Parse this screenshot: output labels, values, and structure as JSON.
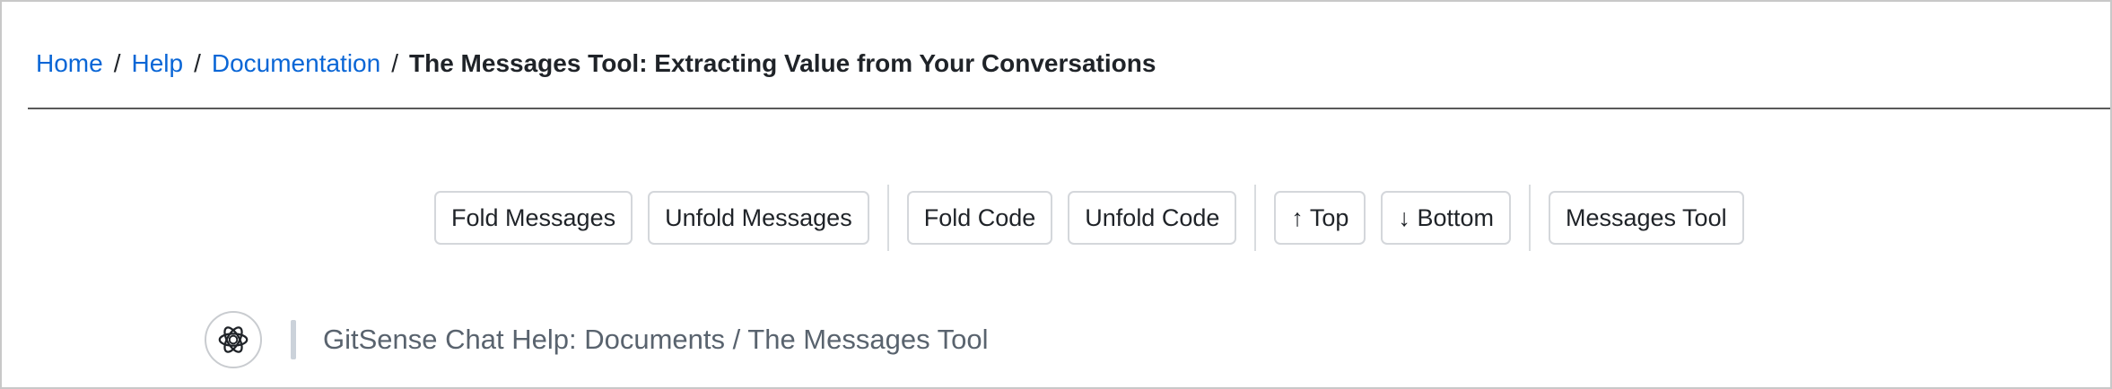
{
  "breadcrumb": {
    "home": "Home",
    "help": "Help",
    "documentation": "Documentation",
    "separator": "/",
    "current": "The Messages Tool: Extracting Value from Your Conversations"
  },
  "toolbar": {
    "fold_messages": "Fold Messages",
    "unfold_messages": "Unfold Messages",
    "fold_code": "Fold Code",
    "unfold_code": "Unfold Code",
    "top": "↑ Top",
    "bottom": "↓ Bottom",
    "messages_tool": "Messages Tool"
  },
  "chat": {
    "avatar_icon": "assistant-logo-icon",
    "title": "GitSense Chat Help: Documents / The Messages Tool"
  },
  "colors": {
    "link": "#0a66d6",
    "text": "#1f2328",
    "muted_text": "#59636e",
    "button_border": "#d4d7db",
    "divider": "#d9dcdf",
    "quote_bar": "#cbd2da"
  }
}
